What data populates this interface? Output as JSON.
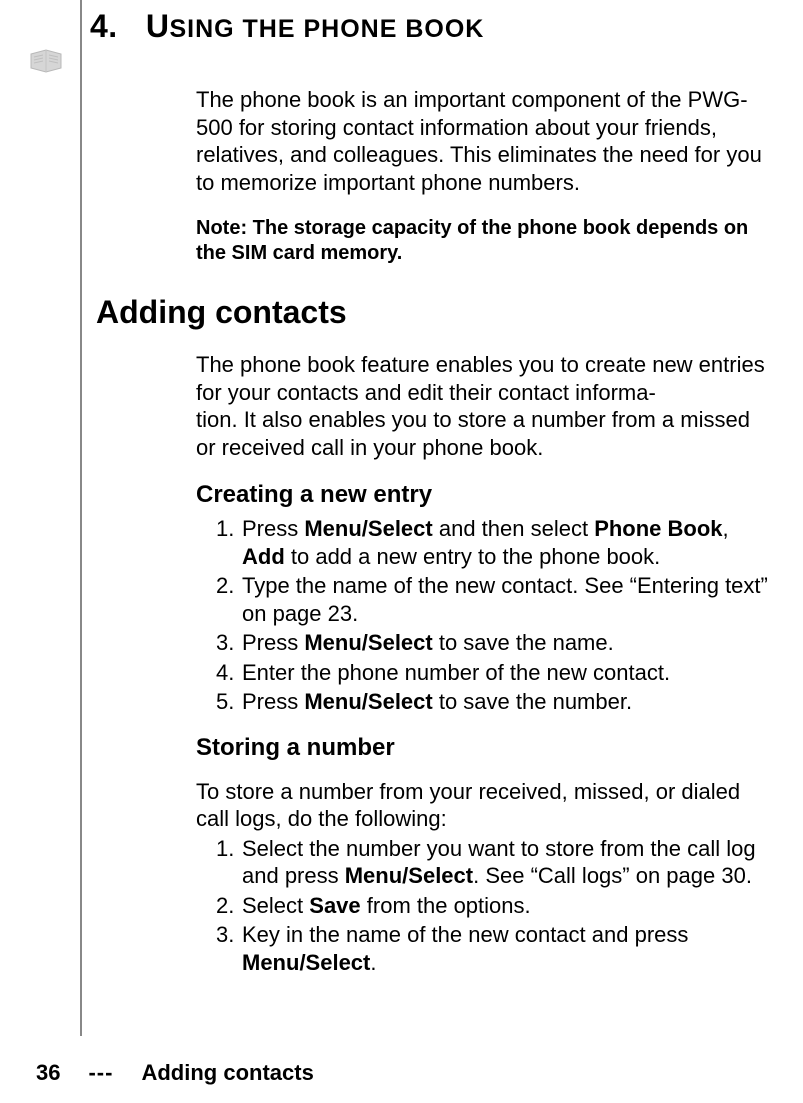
{
  "chapter": {
    "number": "4.",
    "title_first": "U",
    "title_rest": "SING THE PHONE BOOK"
  },
  "intro": "The phone book is an important component of the PWG-500 for storing contact information about your friends, relatives, and colleagues. This eliminates the need for you to memorize important phone numbers.",
  "note": "Note: The storage capacity of the phone book depends on the SIM card memory.",
  "section1": {
    "heading": "Adding contacts",
    "para": "The phone book feature enables you to create new entries for your contacts and edit their contact informa-\ntion. It also enables you to store a number from a missed or received call in your phone book."
  },
  "sub1": {
    "heading": "Creating a new entry",
    "items": [
      {
        "n": "1.",
        "pre": "Press ",
        "b1": "Menu/Select",
        "mid": " and then select ",
        "b2": "Phone Book",
        "post": ", ",
        "line2b": "Add",
        "line2": " to add a new entry to the phone book."
      },
      {
        "n": "2.",
        "text": "Type the name of the new contact. See “Entering text” on page 23."
      },
      {
        "n": "3.",
        "pre": "Press ",
        "b1": "Menu/Select",
        "post": " to save the name."
      },
      {
        "n": "4.",
        "text": "Enter the phone number of the new contact."
      },
      {
        "n": "5.",
        "pre": "Press ",
        "b1": "Menu/Select",
        "post": " to save the number."
      }
    ]
  },
  "sub2": {
    "heading": "Storing a number",
    "para": "To store a number from your received, missed, or dialed call logs, do the following:",
    "items": [
      {
        "n": "1.",
        "pre": "Select the number you want to store from the call log and press ",
        "b1": "Menu/Select",
        "post": ". See “Call logs” on page 30."
      },
      {
        "n": "2.",
        "pre": "Select ",
        "b1": "Save",
        "post": " from the options."
      },
      {
        "n": "3.",
        "pre": "Key in the name of the new contact and press ",
        "b1": "Menu/Select",
        "post": "."
      }
    ]
  },
  "footer": {
    "page": "36",
    "sep": "---",
    "title": "Adding contacts"
  }
}
